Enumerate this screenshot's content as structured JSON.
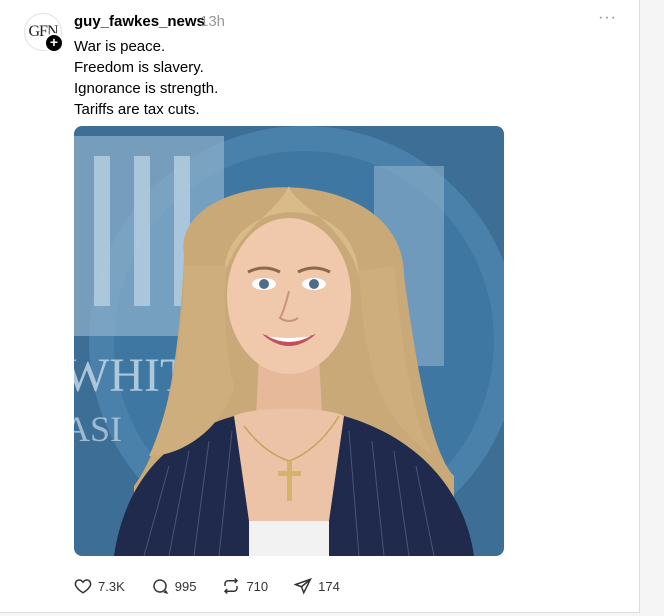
{
  "post": {
    "avatar_text": "GFN",
    "username": "guy_fawkes_news",
    "time": "13h",
    "more_label": "···",
    "lines": [
      "War is peace.",
      "Freedom is slavery.",
      "Ignorance is strength.",
      "Tariffs are tax cuts."
    ],
    "photo_icon": "photo-woman-pressroom",
    "actions": {
      "likes": "7.3K",
      "replies": "995",
      "reposts": "710",
      "shares": "174"
    }
  },
  "colors": {
    "background": "#ffffff",
    "muted": "#999999",
    "text": "#000000"
  }
}
